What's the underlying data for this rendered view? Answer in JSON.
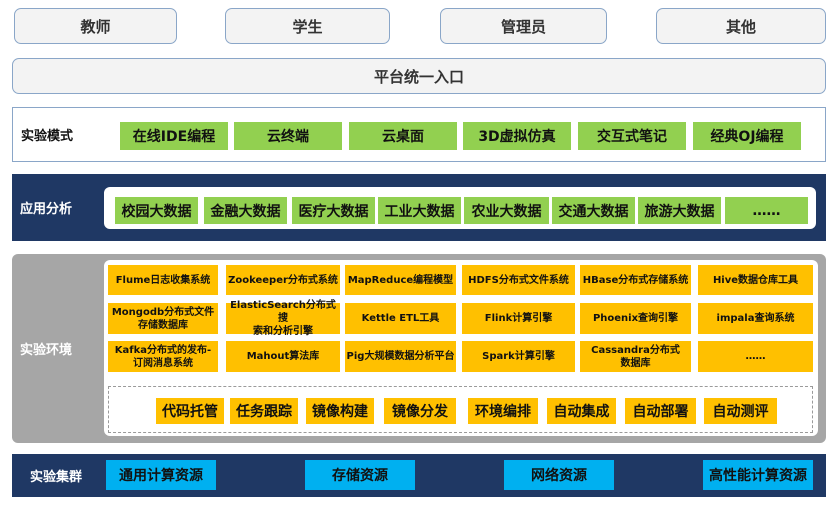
{
  "roles": [
    "教师",
    "学生",
    "管理员",
    "其他"
  ],
  "entry": "平台统一入口",
  "modes": {
    "label": "实验模式",
    "items": [
      "在线IDE编程",
      "云终端",
      "云桌面",
      "3D虚拟仿真",
      "交互式笔记",
      "经典OJ编程"
    ]
  },
  "analysis": {
    "label": "应用分析",
    "items": [
      "校园大数据",
      "金融大数据",
      "医疗大数据",
      "工业大数据",
      "农业大数据",
      "交通大数据",
      "旅游大数据",
      "……"
    ]
  },
  "environment": {
    "label": "实验环境",
    "tech": [
      "Flume日志收集系统",
      "Zookeeper分布式系统",
      "MapReduce编程模型",
      "HDFS分布式文件系统",
      "HBase分布式存储系统",
      "Hive数据仓库工具",
      "Mongodb分布式文件\n存储数据库",
      "ElasticSearch分布式搜\n索和分析引擎",
      "Kettle ETL工具",
      "Flink计算引擎",
      "Phoenix查询引擎",
      "impala查询系统",
      "Kafka分布式的发布-\n订阅消息系统",
      "Mahout算法库",
      "Pig大规模数据分析平台",
      "Spark计算引擎",
      "Cassandra分布式\n数据库",
      "……"
    ],
    "tools": [
      "代码托管",
      "任务跟踪",
      "镜像构建",
      "镜像分发",
      "环境编排",
      "自动集成",
      "自动部署",
      "自动测评"
    ]
  },
  "cluster": {
    "label": "实验集群",
    "items": [
      "通用计算资源",
      "存储资源",
      "网络资源",
      "高性能计算资源"
    ]
  },
  "colors": {
    "green": "#92d050",
    "orange": "#ffc000",
    "blue": "#00b0f0",
    "navy": "#1f3864",
    "gray_panel": "#a6a6a6",
    "border": "#8aa6c8"
  }
}
